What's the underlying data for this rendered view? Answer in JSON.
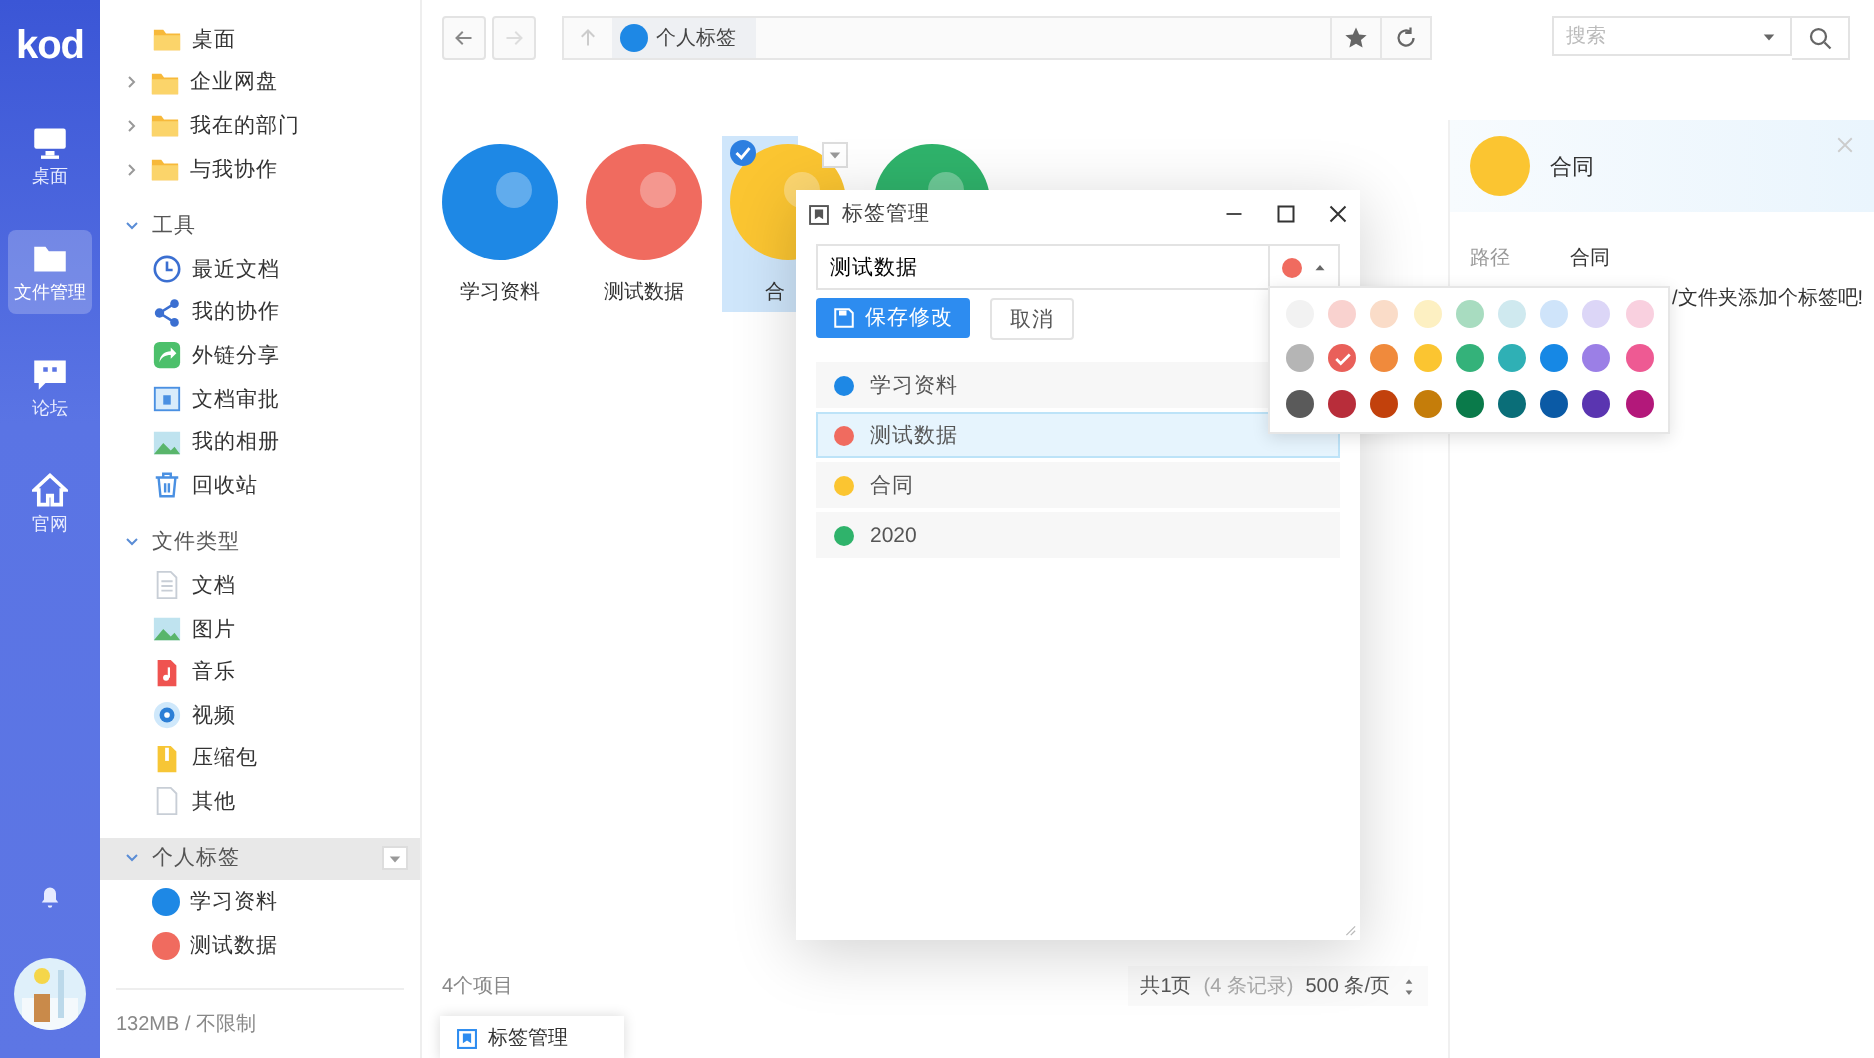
{
  "rail": {
    "logo": "kod",
    "items": [
      {
        "label": "桌面",
        "selected": false
      },
      {
        "label": "文件管理",
        "selected": true
      },
      {
        "label": "论坛",
        "selected": false
      },
      {
        "label": "官网",
        "selected": false
      }
    ]
  },
  "tree": [
    {
      "label": "桌面",
      "kind": "folder"
    },
    {
      "label": "企业网盘",
      "kind": "folder",
      "expanded": false
    },
    {
      "label": "我在的部门",
      "kind": "folder",
      "expanded": false
    },
    {
      "label": "与我协作",
      "kind": "folder",
      "expanded": false
    },
    {
      "label": "工具",
      "kind": "section",
      "expanded": true,
      "selected": false,
      "children": [
        {
          "label": "最近文档",
          "kind": "clock"
        },
        {
          "label": "我的协作",
          "kind": "share"
        },
        {
          "label": "外链分享",
          "kind": "link"
        },
        {
          "label": "文档审批",
          "kind": "approve"
        },
        {
          "label": "我的相册",
          "kind": "album"
        },
        {
          "label": "回收站",
          "kind": "trash"
        }
      ]
    },
    {
      "label": "文件类型",
      "kind": "section",
      "expanded": true,
      "selected": false,
      "children": [
        {
          "label": "文档",
          "kind": "doc"
        },
        {
          "label": "图片",
          "kind": "image"
        },
        {
          "label": "音乐",
          "kind": "music"
        },
        {
          "label": "视频",
          "kind": "video"
        },
        {
          "label": "压缩包",
          "kind": "zip"
        },
        {
          "label": "其他",
          "kind": "file"
        }
      ]
    },
    {
      "label": "个人标签",
      "kind": "section",
      "expanded": true,
      "selected": true,
      "children": [
        {
          "label": "学习资料",
          "kind": "tag",
          "color": "#1e88e5"
        },
        {
          "label": "测试数据",
          "kind": "tag",
          "color": "#f06b5f"
        }
      ]
    }
  ],
  "quota": "132MB / 不限制",
  "toolbar": {
    "breadcrumb": "个人标签",
    "search": {
      "placeholder": "搜索"
    }
  },
  "files": [
    {
      "name": "学习资料",
      "color": "#1e88e5",
      "selected": false
    },
    {
      "name": "测试数据",
      "color": "#f06b5f",
      "selected": false
    },
    {
      "name": "合",
      "color": "#fbc531",
      "selected": true
    },
    {
      "color": "#2fb36b",
      "selected": false
    }
  ],
  "status": {
    "count": "4个项目",
    "pages": "共1页",
    "records": "(4 条记录)",
    "per_page": "500 条/页"
  },
  "info": {
    "title": "合同",
    "color": "#fbc531",
    "props": [
      {
        "label": "路径",
        "value": "合同"
      }
    ],
    "hint": "/文件夹添加个标签吧!"
  },
  "dialog": {
    "title": "标签管理",
    "name": {
      "value": "测试数据"
    },
    "color": "#f06b5f",
    "save": "保存修改",
    "cancel": "取消",
    "tags": [
      {
        "label": "学习资料",
        "color": "#1e88e5",
        "selected": false
      },
      {
        "label": "测试数据",
        "color": "#f06b5f",
        "selected": true
      },
      {
        "label": "合同",
        "color": "#fbc531",
        "selected": false
      },
      {
        "label": "2020",
        "color": "#2fb36b",
        "selected": false
      }
    ]
  },
  "palette": [
    {
      "color": "#f2f2f2",
      "selected": false
    },
    {
      "color": "#f9d2cf",
      "selected": false
    },
    {
      "color": "#fadcc8",
      "selected": false
    },
    {
      "color": "#fdf0c2",
      "selected": false
    },
    {
      "color": "#a8dcc0",
      "selected": false
    },
    {
      "color": "#cfe9ef",
      "selected": false
    },
    {
      "color": "#cfe4fa",
      "selected": false
    },
    {
      "color": "#dcd6f7",
      "selected": false
    },
    {
      "color": "#f9d0df",
      "selected": false
    },
    {
      "color": "#b5b5b5",
      "selected": false
    },
    {
      "color": "#e9605a",
      "selected": true
    },
    {
      "color": "#f08a3c",
      "selected": false
    },
    {
      "color": "#fbc531",
      "selected": false
    },
    {
      "color": "#34b27a",
      "selected": false
    },
    {
      "color": "#2fb0b5",
      "selected": false
    },
    {
      "color": "#1688e5",
      "selected": false
    },
    {
      "color": "#9b7fe6",
      "selected": false
    },
    {
      "color": "#ee5a93",
      "selected": false
    },
    {
      "color": "#5a5a5a",
      "selected": false
    },
    {
      "color": "#b82d3a",
      "selected": false
    },
    {
      "color": "#c2410c",
      "selected": false
    },
    {
      "color": "#c57d0a",
      "selected": false
    },
    {
      "color": "#0a7a4a",
      "selected": false
    },
    {
      "color": "#0a6e78",
      "selected": false
    },
    {
      "color": "#0b5aa5",
      "selected": false
    },
    {
      "color": "#5a35b0",
      "selected": false
    },
    {
      "color": "#b3187a",
      "selected": false
    }
  ],
  "taskbar": [
    {
      "label": "标签管理"
    }
  ]
}
